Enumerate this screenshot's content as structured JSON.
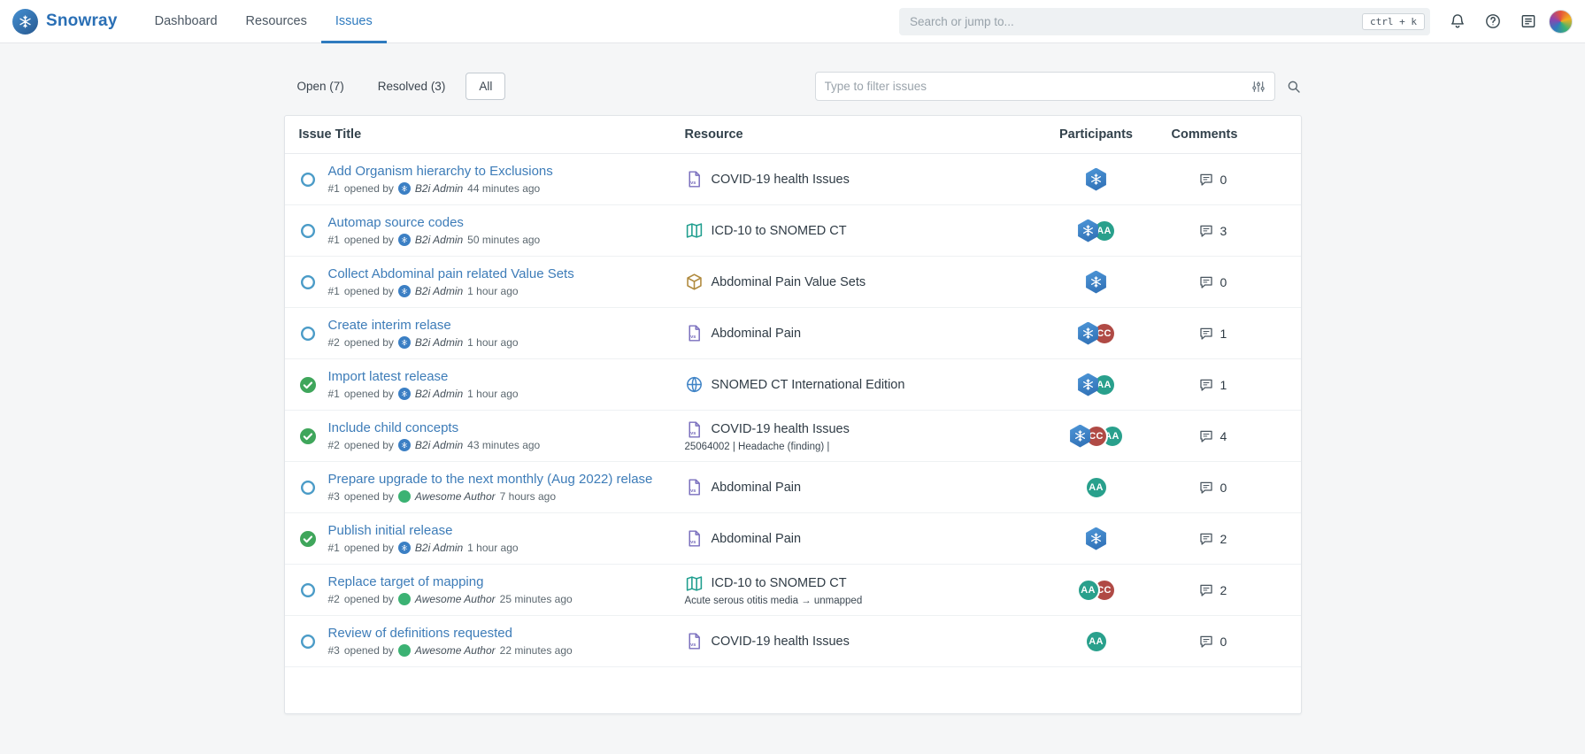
{
  "navbar": {
    "brand": "Snowray",
    "items": [
      {
        "label": "Dashboard"
      },
      {
        "label": "Resources"
      },
      {
        "label": "Issues"
      }
    ],
    "search_placeholder": "Search or jump to...",
    "shortcut": "ctrl + k"
  },
  "toolbar": {
    "tabs": [
      {
        "label": "Open (7)"
      },
      {
        "label": "Resolved (3)"
      },
      {
        "label": "All"
      }
    ],
    "filter_placeholder": "Type to filter issues"
  },
  "labels": {
    "opened_by": "opened by"
  },
  "colors": {
    "accent": "#2f7bbf",
    "link": "#3d7cb8",
    "open_status": "#4a9bc7",
    "resolved_status": "#3fa65b",
    "participant": {
      "b2i": "#2d6cb2",
      "AA": "#29a08c",
      "CC": "#b04a45"
    },
    "author_dot": {
      "b2i": "#3b7fc4",
      "awesome": "#3bb273"
    },
    "resource_icon": {
      "file": "#7a6fbe",
      "map": "#1f9e8e",
      "package": "#b08a3e",
      "globe": "#3f83c6"
    }
  },
  "table": {
    "headers": {
      "title": "Issue Title",
      "resource": "Resource",
      "participants": "Participants",
      "comments": "Comments"
    },
    "rows": [
      {
        "status": "open",
        "title": "Add Organism hierarchy to Exclusions",
        "ref": "#1",
        "author": "B2i Admin",
        "author_type": "b2i",
        "time": "44 minutes ago",
        "resource": "COVID-19 health Issues",
        "resource_icon": "file",
        "resource_sub": "",
        "participants": [
          "b2i"
        ],
        "comments": 0
      },
      {
        "status": "open",
        "title": "Automap source codes",
        "ref": "#1",
        "author": "B2i Admin",
        "author_type": "b2i",
        "time": "50 minutes ago",
        "resource": "ICD-10 to SNOMED CT",
        "resource_icon": "map",
        "resource_sub": "",
        "participants": [
          "b2i",
          "AA"
        ],
        "comments": 3
      },
      {
        "status": "open",
        "title": "Collect Abdominal pain related Value Sets",
        "ref": "#1",
        "author": "B2i Admin",
        "author_type": "b2i",
        "time": "1 hour ago",
        "resource": "Abdominal Pain Value Sets",
        "resource_icon": "package",
        "resource_sub": "",
        "participants": [
          "b2i"
        ],
        "comments": 0
      },
      {
        "status": "open",
        "title": "Create interim relase",
        "ref": "#2",
        "author": "B2i Admin",
        "author_type": "b2i",
        "time": "1 hour ago",
        "resource": "Abdominal Pain",
        "resource_icon": "file",
        "resource_sub": "",
        "participants": [
          "b2i",
          "CC"
        ],
        "comments": 1
      },
      {
        "status": "resolved",
        "title": "Import latest release",
        "ref": "#1",
        "author": "B2i Admin",
        "author_type": "b2i",
        "time": "1 hour ago",
        "resource": "SNOMED CT International Edition",
        "resource_icon": "globe",
        "resource_sub": "",
        "participants": [
          "b2i",
          "AA"
        ],
        "comments": 1
      },
      {
        "status": "resolved",
        "title": "Include child concepts",
        "ref": "#2",
        "author": "B2i Admin",
        "author_type": "b2i",
        "time": "43 minutes ago",
        "resource": "COVID-19 health Issues",
        "resource_icon": "file",
        "resource_sub": "25064002 | Headache (finding) |",
        "participants": [
          "b2i",
          "CC",
          "AA"
        ],
        "comments": 4
      },
      {
        "status": "open",
        "title": "Prepare upgrade to the next monthly (Aug 2022) relase",
        "ref": "#3",
        "author": "Awesome Author",
        "author_type": "awesome",
        "time": "7 hours ago",
        "resource": "Abdominal Pain",
        "resource_icon": "file",
        "resource_sub": "",
        "participants": [
          "AA"
        ],
        "comments": 0
      },
      {
        "status": "resolved",
        "title": "Publish initial release",
        "ref": "#1",
        "author": "B2i Admin",
        "author_type": "b2i",
        "time": "1 hour ago",
        "resource": "Abdominal Pain",
        "resource_icon": "file",
        "resource_sub": "",
        "participants": [
          "b2i"
        ],
        "comments": 2
      },
      {
        "status": "open",
        "title": "Replace target of mapping",
        "ref": "#2",
        "author": "Awesome Author",
        "author_type": "awesome",
        "time": "25 minutes ago",
        "resource": "ICD-10 to SNOMED CT",
        "resource_icon": "map",
        "resource_sub": "Acute serous otitis media → unmapped",
        "participants": [
          "AA",
          "CC"
        ],
        "comments": 2
      },
      {
        "status": "open",
        "title": "Review of definitions requested",
        "ref": "#3",
        "author": "Awesome Author",
        "author_type": "awesome",
        "time": "22 minutes ago",
        "resource": "COVID-19 health Issues",
        "resource_icon": "file",
        "resource_sub": "",
        "participants": [
          "AA"
        ],
        "comments": 0
      }
    ]
  }
}
